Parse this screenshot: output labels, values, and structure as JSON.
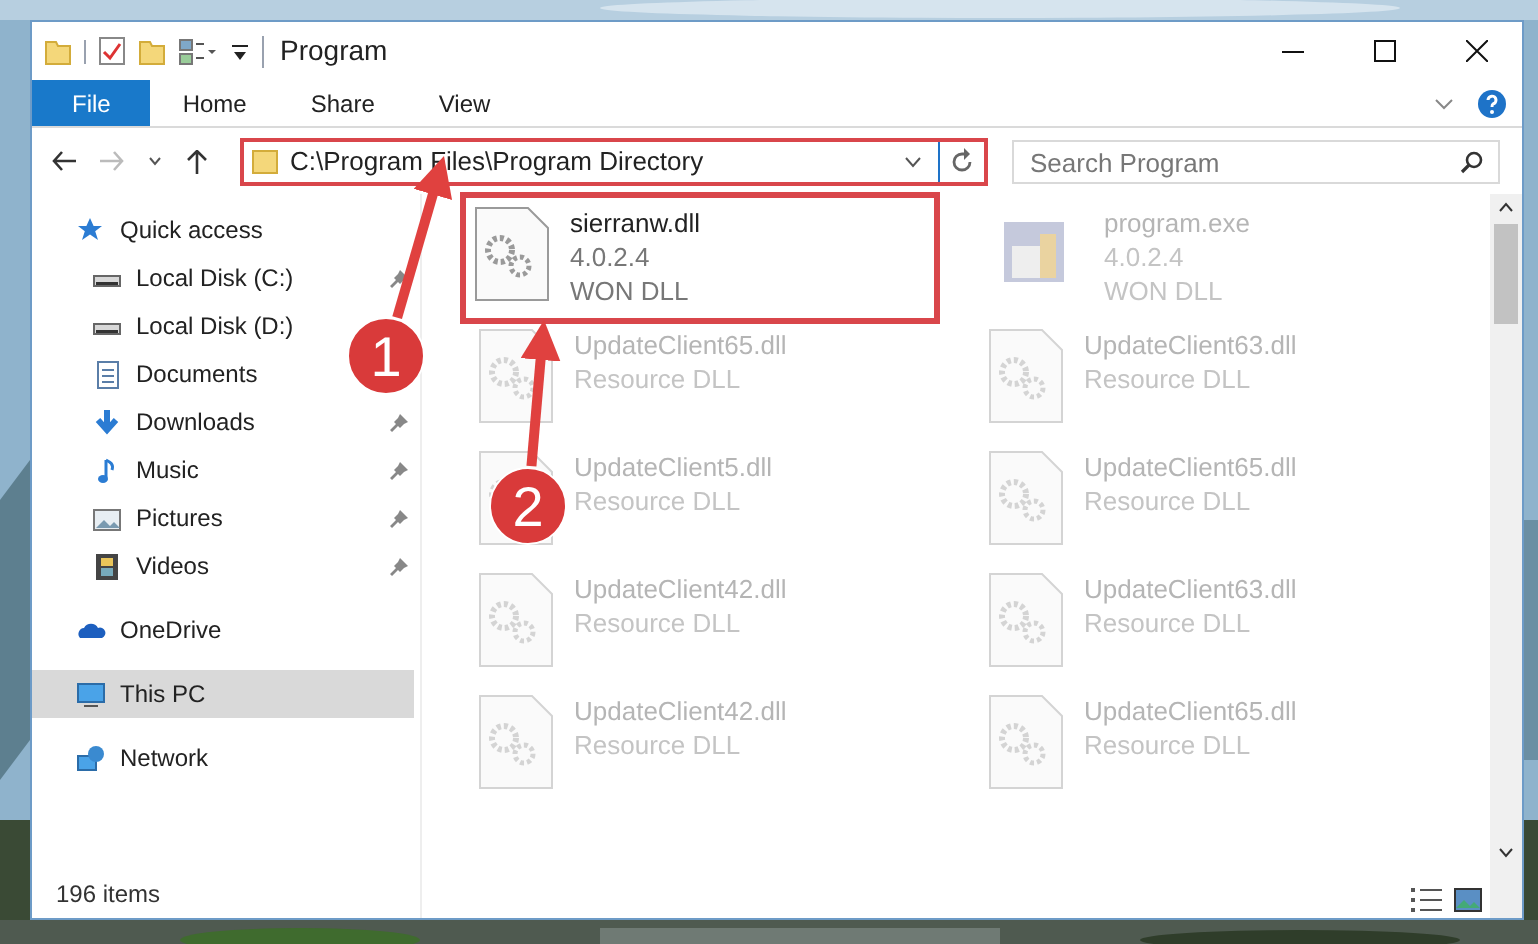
{
  "window": {
    "title": "Program"
  },
  "ribbon_tabs": [
    {
      "label": "File",
      "selected": true
    },
    {
      "label": "Home",
      "selected": false
    },
    {
      "label": "Share",
      "selected": false
    },
    {
      "label": "View",
      "selected": false
    }
  ],
  "address": {
    "path": "C:\\Program Files\\Program Directory"
  },
  "search": {
    "placeholder": "Search Program"
  },
  "sidebar": {
    "items": [
      {
        "label": "Quick access",
        "kind": "star",
        "selected": false,
        "children": [
          {
            "label": "Local Disk (C:)",
            "kind": "disk",
            "pinned": true,
            "selected": false
          },
          {
            "label": "Local Disk (D:)",
            "kind": "disk",
            "pinned": false,
            "selected": false
          },
          {
            "label": "Documents",
            "kind": "document",
            "pinned": false,
            "selected": false
          },
          {
            "label": "Downloads",
            "kind": "download",
            "pinned": true,
            "selected": false
          },
          {
            "label": "Music",
            "kind": "music",
            "pinned": true,
            "selected": false
          },
          {
            "label": "Pictures",
            "kind": "pictures",
            "pinned": true,
            "selected": false
          },
          {
            "label": "Videos",
            "kind": "video",
            "pinned": true,
            "selected": false
          }
        ]
      },
      {
        "label": "OneDrive",
        "kind": "cloud",
        "selected": false
      },
      {
        "label": "This PC",
        "kind": "pc",
        "selected": true
      },
      {
        "label": "Network",
        "kind": "network",
        "selected": false
      }
    ]
  },
  "files": [
    {
      "name": "sierranw.dll",
      "lines": [
        "4.0.2.4",
        "WON DLL"
      ],
      "kind": "dll",
      "dimmed": false,
      "highlighted": true
    },
    {
      "name": "program.exe",
      "lines": [
        "4.0.2.4",
        "WON DLL"
      ],
      "kind": "exe",
      "dimmed": true,
      "highlighted": false
    },
    {
      "name": "UpdateClient65.dll",
      "lines": [
        "Resource DLL"
      ],
      "kind": "dll",
      "dimmed": true,
      "highlighted": false
    },
    {
      "name": "UpdateClient63.dll",
      "lines": [
        "Resource DLL"
      ],
      "kind": "dll",
      "dimmed": true,
      "highlighted": false
    },
    {
      "name": "UpdateClient5.dll",
      "lines": [
        "Resource DLL"
      ],
      "kind": "dll",
      "dimmed": true,
      "highlighted": false
    },
    {
      "name": "UpdateClient65.dll",
      "lines": [
        "Resource DLL"
      ],
      "kind": "dll",
      "dimmed": true,
      "highlighted": false
    },
    {
      "name": "UpdateClient42.dll",
      "lines": [
        "Resource DLL"
      ],
      "kind": "dll",
      "dimmed": true,
      "highlighted": false
    },
    {
      "name": "UpdateClient63.dll",
      "lines": [
        "Resource DLL"
      ],
      "kind": "dll",
      "dimmed": true,
      "highlighted": false
    },
    {
      "name": "UpdateClient42.dll",
      "lines": [
        "Resource DLL"
      ],
      "kind": "dll",
      "dimmed": true,
      "highlighted": false
    },
    {
      "name": "UpdateClient65.dll",
      "lines": [
        "Resource DLL"
      ],
      "kind": "dll",
      "dimmed": true,
      "highlighted": false
    }
  ],
  "status_bar": {
    "count": "196 items"
  },
  "annotations": [
    {
      "number": "1"
    },
    {
      "number": "2"
    }
  ]
}
